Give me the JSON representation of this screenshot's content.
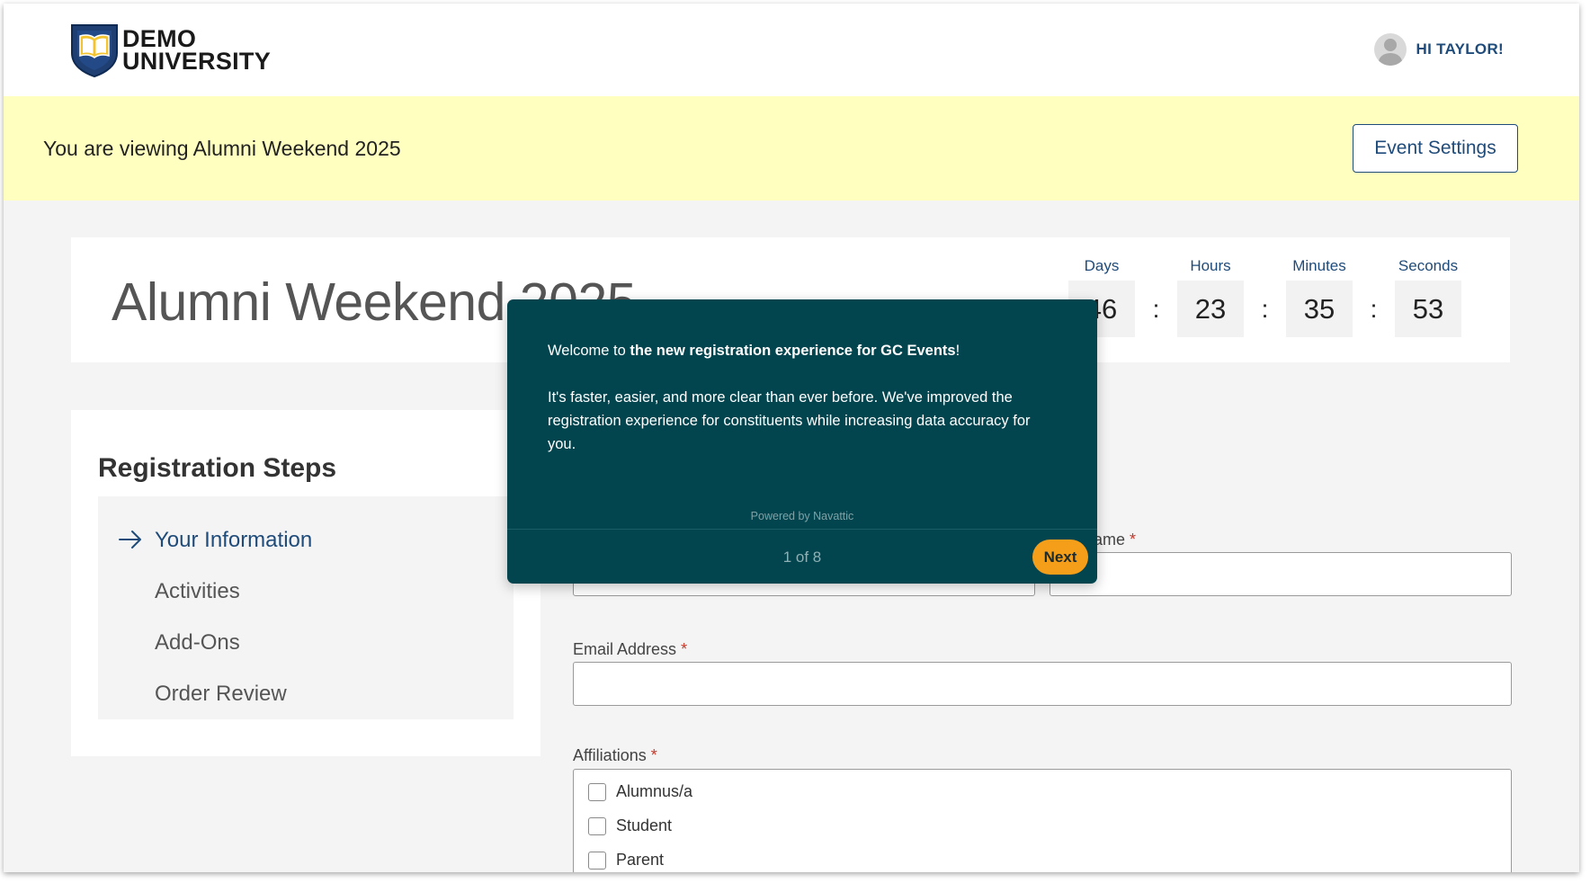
{
  "header": {
    "logo_line1": "DEMO",
    "logo_line2": "UNIVERSITY",
    "user_greeting": "HI TAYLOR!"
  },
  "banner": {
    "text": "You are viewing Alumni Weekend 2025",
    "settings_button": "Event Settings"
  },
  "event": {
    "title": "Alumni Weekend 2025",
    "countdown": [
      {
        "label": "Days",
        "value": "46"
      },
      {
        "label": "Hours",
        "value": "23"
      },
      {
        "label": "Minutes",
        "value": "35"
      },
      {
        "label": "Seconds",
        "value": "53"
      }
    ],
    "separator": ":"
  },
  "steps": {
    "title": "Registration Steps",
    "items": [
      {
        "label": "Your Information",
        "active": true
      },
      {
        "label": "Activities",
        "active": false
      },
      {
        "label": "Add-Ons",
        "active": false
      },
      {
        "label": "Order Review",
        "active": false
      }
    ]
  },
  "form": {
    "last_name_label_partial": "ame",
    "required_mark": "*",
    "email_label": "Email Address",
    "affiliations_label": "Affiliations",
    "affiliations": [
      "Alumnus/a",
      "Student",
      "Parent"
    ]
  },
  "tour": {
    "welcome_prefix": "Welcome to ",
    "welcome_bold": "the new registration experience for GC Events",
    "welcome_suffix": "!",
    "body": "It's faster, easier, and more clear than ever before. We've improved the registration experience for constituents while increasing data accuracy for you.",
    "powered_by": "Powered by Navattic",
    "counter": "1 of 8",
    "next_button": "Next"
  },
  "colors": {
    "brand_navy": "#1f4b7a",
    "banner_yellow": "#ffffc0",
    "tour_teal": "#02454f",
    "next_orange": "#f59e1a"
  },
  "icons": {
    "logo": "shield-book-icon",
    "avatar": "user-avatar-icon",
    "active_step": "arrow-right-icon"
  }
}
